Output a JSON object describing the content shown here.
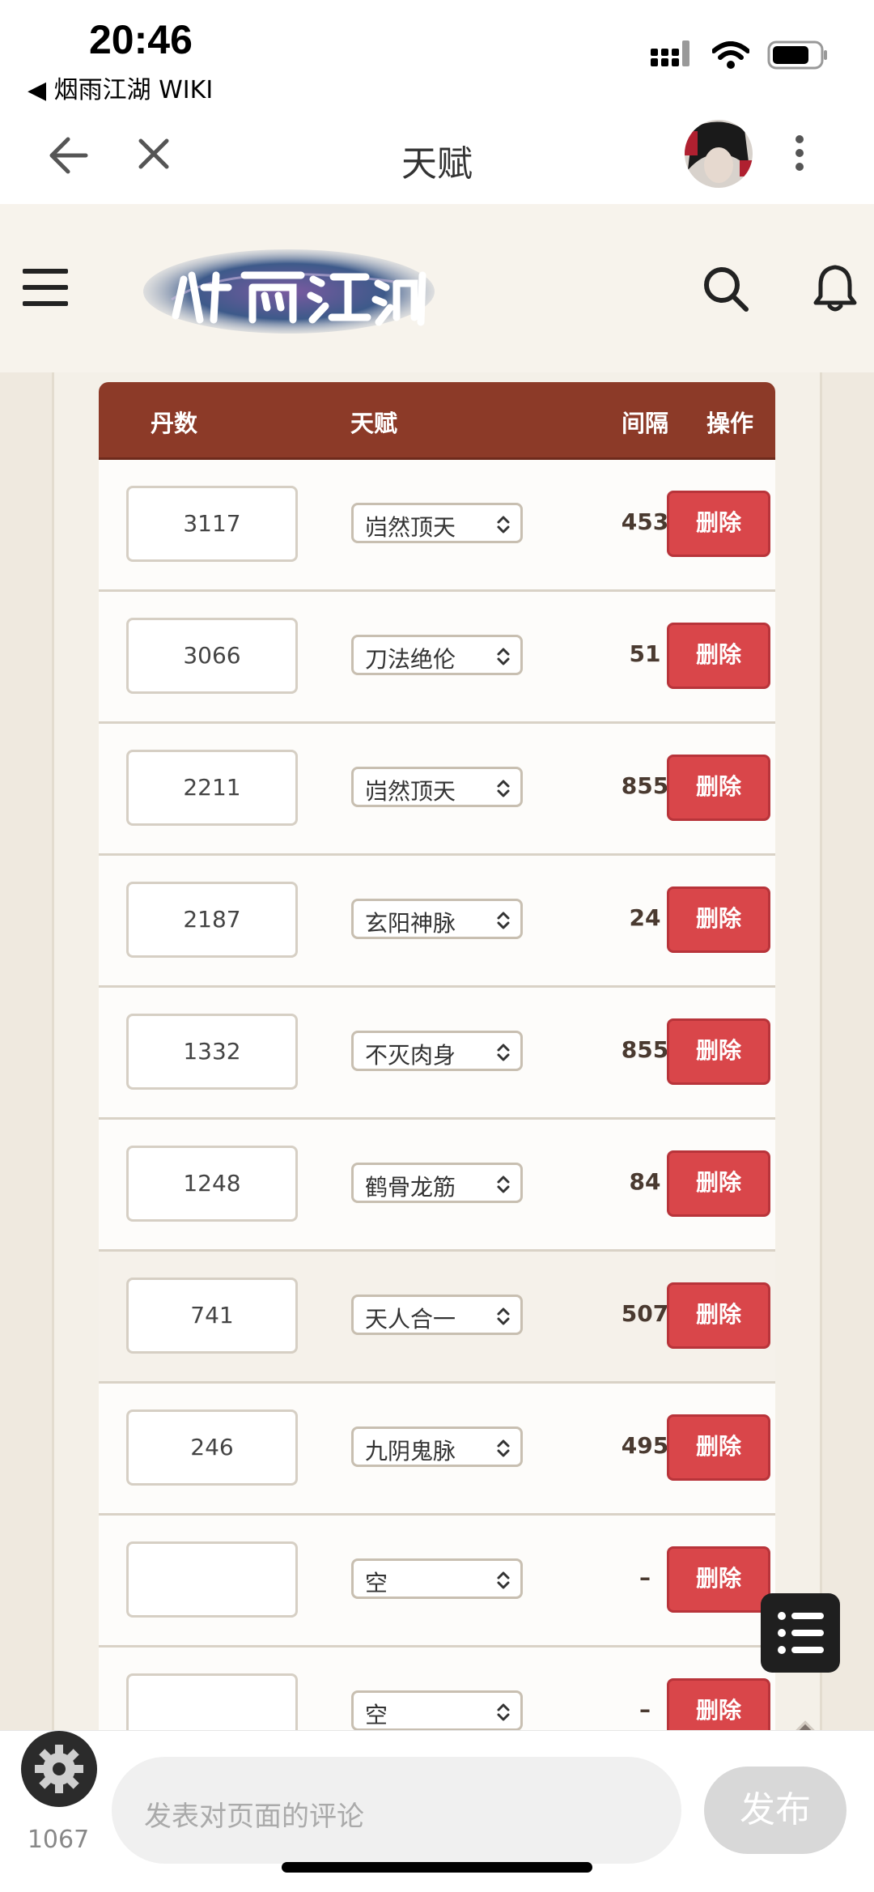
{
  "status": {
    "time": "20:46",
    "back_app": "◀ 烟雨江湖 WIKI"
  },
  "nav": {
    "title": "天赋"
  },
  "table": {
    "headers": {
      "dan": "丹数",
      "talent": "天赋",
      "interval": "间隔",
      "action": "操作"
    },
    "delete_label": "删除",
    "rows": [
      {
        "dan": "3117",
        "talent": "岿然顶天",
        "interval": "453"
      },
      {
        "dan": "3066",
        "talent": "刀法绝伦",
        "interval": "51"
      },
      {
        "dan": "2211",
        "talent": "岿然顶天",
        "interval": "855"
      },
      {
        "dan": "2187",
        "talent": "玄阳神脉",
        "interval": "24"
      },
      {
        "dan": "1332",
        "talent": "不灭肉身",
        "interval": "855"
      },
      {
        "dan": "1248",
        "talent": "鹤骨龙筋",
        "interval": "84"
      },
      {
        "dan": "741",
        "talent": "天人合一",
        "interval": "507"
      },
      {
        "dan": "246",
        "talent": "九阴鬼脉",
        "interval": "495"
      },
      {
        "dan": "",
        "talent": "空",
        "interval": "–"
      },
      {
        "dan": "",
        "talent": "空",
        "interval": "–"
      }
    ]
  },
  "bottom": {
    "count": "1067",
    "comment_placeholder": "发表对页面的评论",
    "publish": "发布"
  },
  "colors": {
    "header_bg": "#8c3a28",
    "delete_bg": "#d9464a",
    "page_bg": "#f7f3ec"
  }
}
